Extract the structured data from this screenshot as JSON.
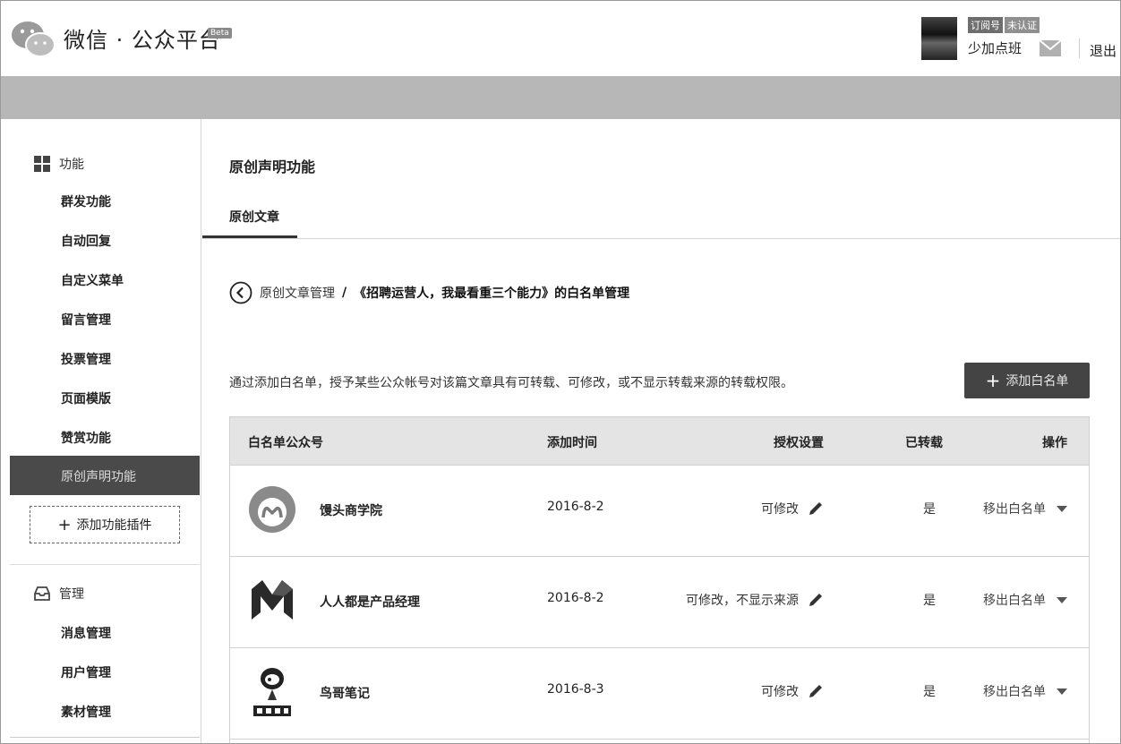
{
  "header": {
    "brand": "微信 · 公众平台",
    "beta": "Beta",
    "account": {
      "type_tag": "订阅号",
      "verify_tag": "未认证",
      "name": "少加点班"
    },
    "logout": "退出",
    "icons": {
      "logo": "wechat-logo-icon",
      "mail": "mail-icon"
    }
  },
  "sidebar": {
    "sections": [
      {
        "title": "功能",
        "icon": "grid-icon",
        "items": [
          "群发功能",
          "自动回复",
          "自定义菜单",
          "留言管理",
          "投票管理",
          "页面模版",
          "赞赏功能",
          "原创声明功能"
        ],
        "active": "原创声明功能"
      },
      {
        "title": "管理",
        "icon": "inbox-icon",
        "items": [
          "消息管理",
          "用户管理",
          "素材管理"
        ]
      }
    ],
    "add_plugin": "添加功能插件"
  },
  "main": {
    "title": "原创声明功能",
    "tab": "原创文章",
    "breadcrumb": {
      "parent": "原创文章管理",
      "separator": "/",
      "current": "《招聘运营人，我最看重三个能力》的白名单管理"
    },
    "description": "通过添加白名单，授予某些公众帐号对该篇文章具有可转载、可修改，或不显示转载来源的转载权限。",
    "add_button": "添加白名单",
    "table": {
      "columns": [
        "白名单公众号",
        "添加时间",
        "授权设置",
        "已转载",
        "操作"
      ],
      "rows": [
        {
          "account": "馒头商学院",
          "date": "2016-8-2",
          "auth": "可修改",
          "reposted": "是",
          "action": "移出白名单",
          "logo": "mantou-logo-icon"
        },
        {
          "account": "人人都是产品经理",
          "date": "2016-8-2",
          "auth": "可修改，不显示来源",
          "reposted": "是",
          "action": "移出白名单",
          "logo": "woshipm-logo-icon"
        },
        {
          "account": "鸟哥笔记",
          "date": "2016-8-3",
          "auth": "可修改",
          "reposted": "是",
          "action": "移出白名单",
          "logo": "niaoge-logo-icon"
        }
      ]
    }
  }
}
